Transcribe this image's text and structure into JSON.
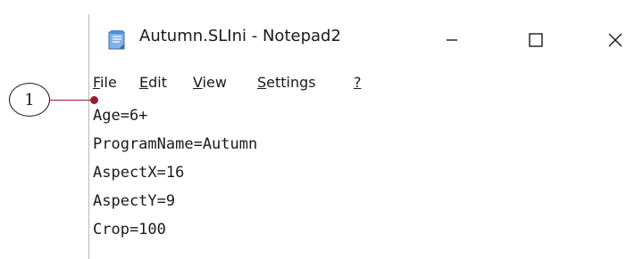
{
  "window": {
    "title": "Autumn.SLIni - Notepad2",
    "controls": {
      "minimize": "minimize",
      "maximize": "maximize",
      "close": "close"
    }
  },
  "menu": {
    "items": [
      {
        "underline": "F",
        "rest": "ile"
      },
      {
        "underline": "E",
        "rest": "dit"
      },
      {
        "underline": "V",
        "rest": "iew"
      },
      {
        "underline": "S",
        "rest": "ettings"
      },
      {
        "underline": "?",
        "rest": ""
      }
    ]
  },
  "editor": {
    "lines": [
      "Age=6+",
      "ProgramName=Autumn",
      "AspectX=16",
      "AspectY=9",
      "Crop=100"
    ]
  },
  "callout": {
    "number": "1"
  },
  "colors": {
    "callout_line": "#9c1b2c",
    "icon_blue": "#4a8fd6"
  }
}
